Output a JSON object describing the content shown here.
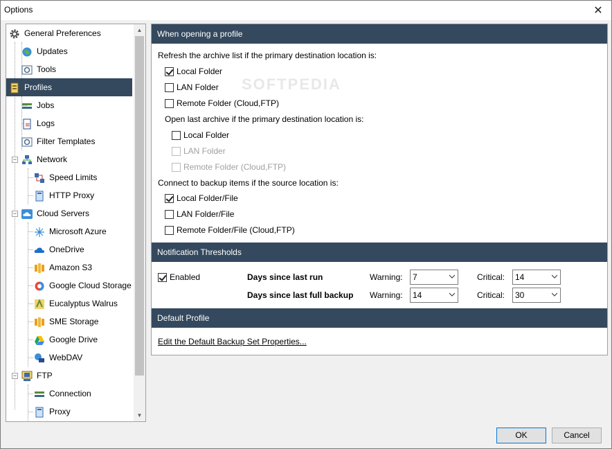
{
  "window": {
    "title": "Options",
    "close_glyph": "✕"
  },
  "watermark": "SOFTPEDIA",
  "tree": {
    "items": [
      {
        "label": "General Preferences",
        "icon": "gear-icon"
      },
      {
        "label": "Updates",
        "icon": "globe-icon"
      },
      {
        "label": "Tools",
        "icon": "tools-icon"
      },
      {
        "label": "Profiles",
        "icon": "profiles-icon"
      },
      {
        "label": "Jobs",
        "icon": "jobs-icon"
      },
      {
        "label": "Logs",
        "icon": "logs-icon"
      },
      {
        "label": "Filter Templates",
        "icon": "filter-icon"
      },
      {
        "label": "Network",
        "icon": "network-icon"
      },
      {
        "label": "Speed Limits",
        "icon": "speed-icon"
      },
      {
        "label": "HTTP Proxy",
        "icon": "proxy-icon"
      },
      {
        "label": "Cloud Servers",
        "icon": "cloud-icon"
      },
      {
        "label": "Microsoft Azure",
        "icon": "azure-icon"
      },
      {
        "label": "OneDrive",
        "icon": "onedrive-icon"
      },
      {
        "label": "Amazon S3",
        "icon": "s3-icon"
      },
      {
        "label": "Google Cloud Storage",
        "icon": "gcs-icon"
      },
      {
        "label": "Eucalyptus Walrus",
        "icon": "walrus-icon"
      },
      {
        "label": "SME Storage",
        "icon": "sme-icon"
      },
      {
        "label": "Google Drive",
        "icon": "gdrive-icon"
      },
      {
        "label": "WebDAV",
        "icon": "webdav-icon"
      },
      {
        "label": "FTP",
        "icon": "ftp-icon"
      },
      {
        "label": "Connection",
        "icon": "connection-icon"
      },
      {
        "label": "Proxy",
        "icon": "proxy-icon"
      }
    ],
    "expander_minus": "−"
  },
  "sections": {
    "opening": {
      "header": "When opening a profile",
      "refresh_label": "Refresh the archive list if the primary destination location is:",
      "refresh_local": "Local Folder",
      "refresh_lan": "LAN Folder",
      "refresh_remote": "Remote Folder (Cloud,FTP)",
      "open_last_label": "Open last archive if the primary destination location is:",
      "open_local": "Local Folder",
      "open_lan": "LAN Folder",
      "open_remote": "Remote Folder (Cloud,FTP)",
      "connect_label": "Connect to backup items if the source location is:",
      "connect_local": "Local Folder/File",
      "connect_lan": "LAN Folder/File",
      "connect_remote": "Remote Folder/File (Cloud,FTP)"
    },
    "notification": {
      "header": "Notification Thresholds",
      "enabled": "Enabled",
      "row1_label": "Days since last run",
      "row2_label": "Days since last full backup",
      "warning": "Warning:",
      "critical": "Critical:",
      "row1_warning": "7",
      "row1_critical": "14",
      "row2_warning": "14",
      "row2_critical": "30"
    },
    "default_profile": {
      "header": "Default Profile",
      "link": "Edit the Default Backup Set Properties..."
    }
  },
  "buttons": {
    "ok": "OK",
    "cancel": "Cancel"
  },
  "colors": {
    "header_bg": "#34495e",
    "selected_bg": "#34495e",
    "accent": "#0078d7"
  }
}
